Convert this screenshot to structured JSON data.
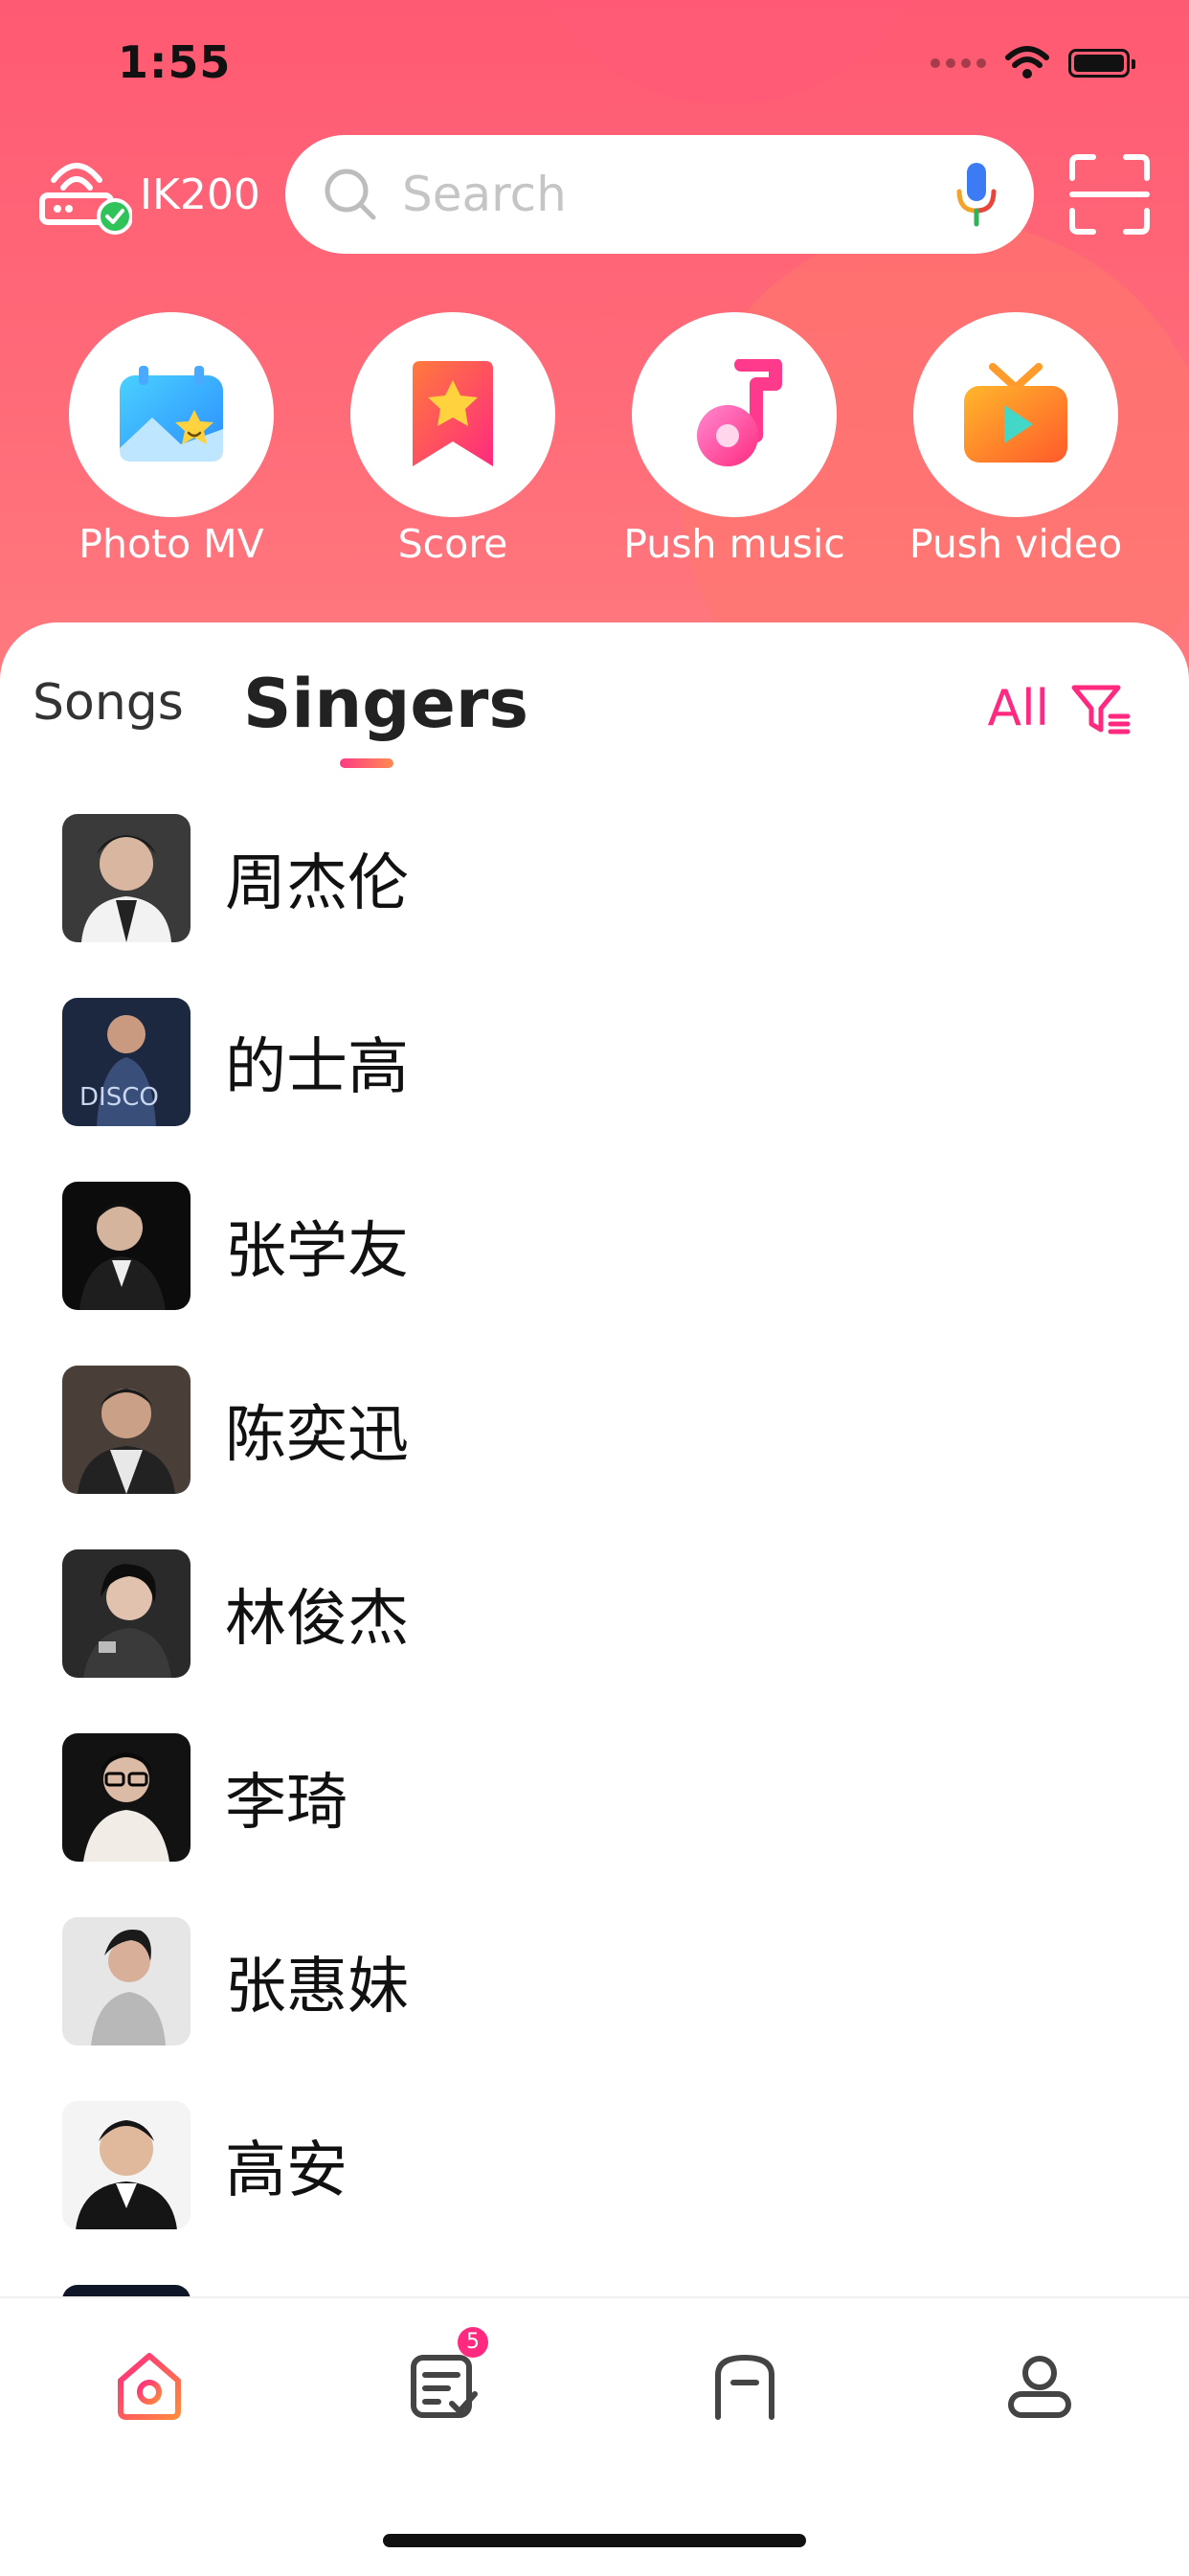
{
  "status_bar": {
    "time": "1:55"
  },
  "header": {
    "device_name": "IK200",
    "search": {
      "placeholder": "Search"
    }
  },
  "quick_actions": [
    {
      "label": "Photo MV",
      "icon": "photo-mv-icon"
    },
    {
      "label": "Score",
      "icon": "score-icon"
    },
    {
      "label": "Push music",
      "icon": "push-music-icon"
    },
    {
      "label": "Push video",
      "icon": "push-video-icon"
    }
  ],
  "tabs": {
    "songs": "Songs",
    "singers": "Singers",
    "active": "Singers"
  },
  "filter": {
    "label": "All",
    "icon": "filter-icon"
  },
  "singers": [
    {
      "name": "周杰伦"
    },
    {
      "name": "的士高"
    },
    {
      "name": "张学友"
    },
    {
      "name": "陈奕迅"
    },
    {
      "name": "林俊杰"
    },
    {
      "name": "李琦"
    },
    {
      "name": "张惠妹"
    },
    {
      "name": "高安"
    }
  ],
  "bottom_nav": {
    "items": [
      "home-icon",
      "playlist-icon",
      "device-icon",
      "profile-icon"
    ],
    "active": "home-icon",
    "playlist_badge": "5"
  },
  "colors": {
    "accent": "#ff2a7f",
    "header_gradient_start": "#ff5a73",
    "header_gradient_end": "#ff7a7e"
  }
}
